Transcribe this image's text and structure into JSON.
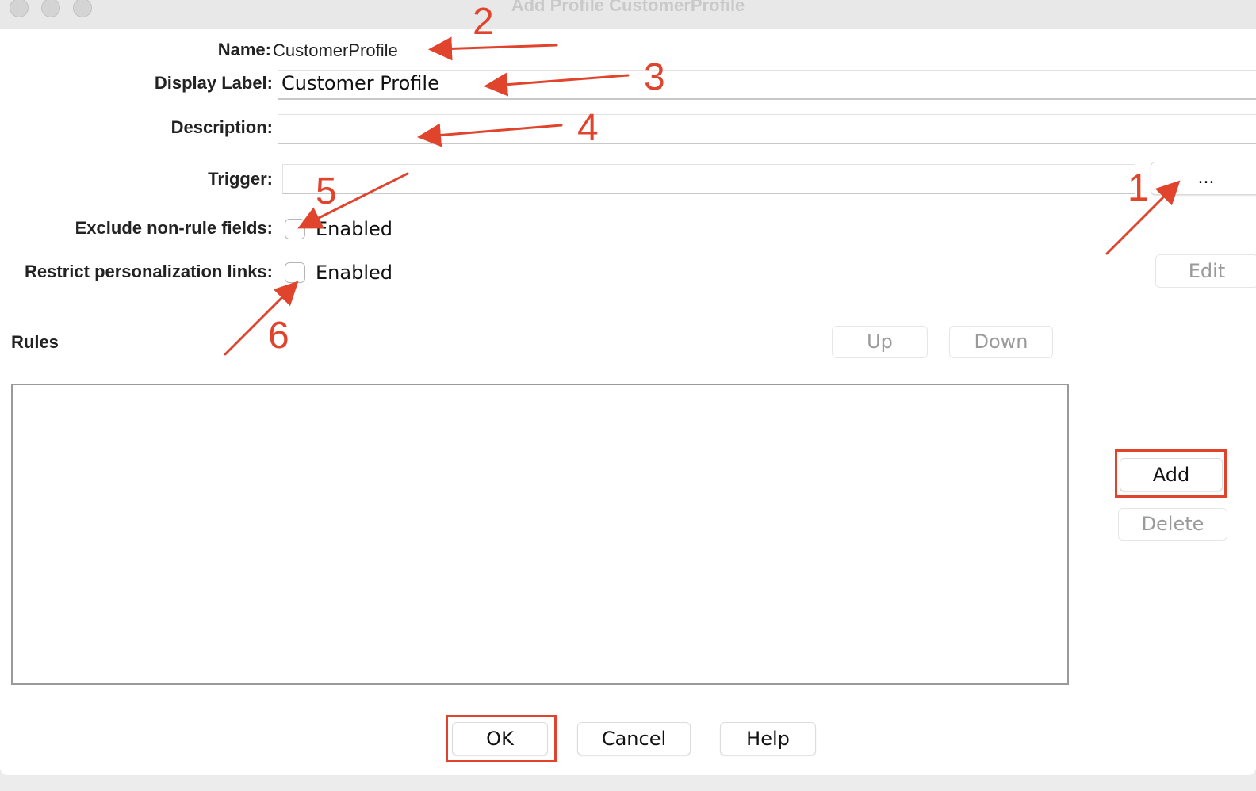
{
  "window": {
    "title": "Add Profile CustomerProfile"
  },
  "form": {
    "name_label": "Name:",
    "name_value": "CustomerProfile",
    "display_label_label": "Display Label:",
    "display_label_value": "Customer Profile",
    "description_label": "Description:",
    "description_value": "",
    "trigger_label": "Trigger:",
    "trigger_value": "",
    "trigger_browse_label": "...",
    "exclude_label": "Exclude non-rule fields:",
    "exclude_checkbox_label": "Enabled",
    "exclude_checked": false,
    "restrict_label": "Restrict personalization links:",
    "restrict_checkbox_label": "Enabled",
    "restrict_checked": false,
    "edit_label": "Edit"
  },
  "rules": {
    "title": "Rules",
    "up_label": "Up",
    "down_label": "Down",
    "add_label": "Add",
    "delete_label": "Delete",
    "items": []
  },
  "footer": {
    "ok_label": "OK",
    "cancel_label": "Cancel",
    "help_label": "Help"
  },
  "annotations": {
    "color": "#e0442c",
    "numbers": [
      "1",
      "2",
      "3",
      "4",
      "5",
      "6"
    ]
  }
}
